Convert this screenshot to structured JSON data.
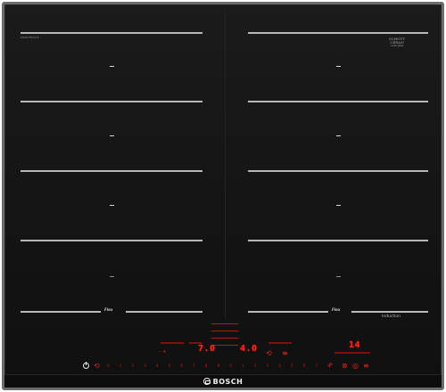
{
  "cooktop": {
    "model_code": "PXX675DC1E",
    "schott_line1": "SCHOTT",
    "schott_line2": "CERAN",
    "schott_line3": "ceran glass",
    "flex_left": "Flex",
    "flex_right": "Flex",
    "induction_label": "Induction",
    "brand": "BOSCH"
  },
  "controls": {
    "left_display": "7.0",
    "right_display": "4.0",
    "timer_display": "14",
    "scale": [
      "0",
      "1",
      "2",
      "3",
      "4",
      "5",
      "6",
      "7",
      "8",
      "9",
      "0",
      "1",
      "2",
      "3",
      "4",
      "5",
      "6",
      "7",
      "8"
    ],
    "minus_plus": "– +",
    "left_power_icon": "power-icon",
    "boost_left": "⟲",
    "boost_right": "⟲",
    "p_symbol": "P",
    "lock_symbol": "⊗",
    "timer_symbol": "◎",
    "menu_symbol": "≡"
  },
  "colors": {
    "glass": "#141414",
    "frame": "#6c6c6c",
    "led": "#e0201c"
  }
}
